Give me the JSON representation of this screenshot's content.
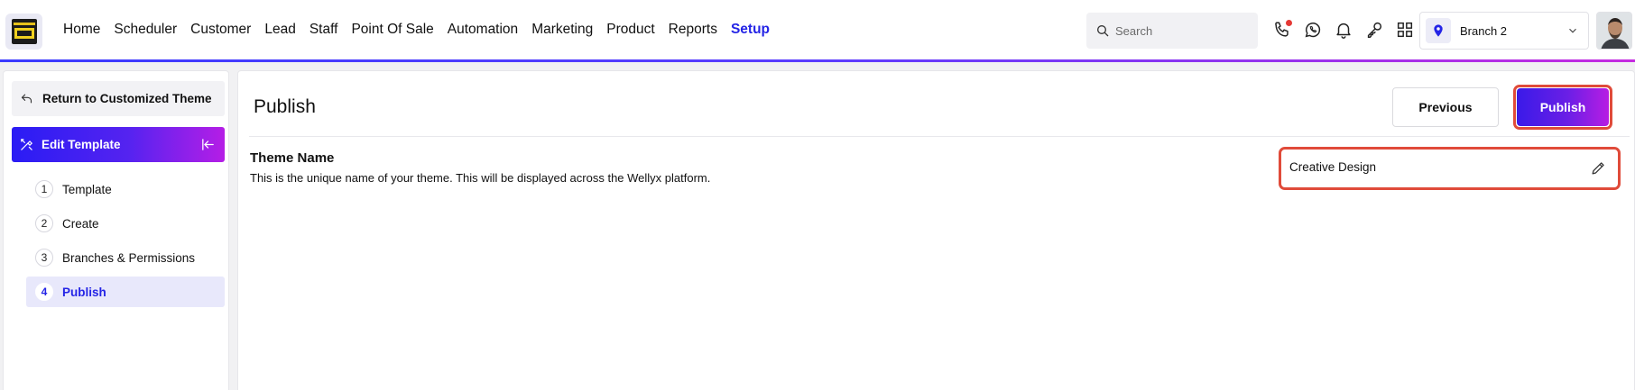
{
  "header": {
    "nav": [
      "Home",
      "Scheduler",
      "Customer",
      "Lead",
      "Staff",
      "Point Of Sale",
      "Automation",
      "Marketing",
      "Product",
      "Reports",
      "Setup"
    ],
    "active_nav": "Setup",
    "search": {
      "placeholder": "Search"
    },
    "icons": [
      "phone-icon",
      "whatsapp-icon",
      "bell-icon",
      "key-icon",
      "apps-grid-icon"
    ],
    "branch": {
      "label": "Branch 2"
    },
    "accent_color": "#2424e6"
  },
  "sidebar": {
    "return_label": "Return to Customized Theme",
    "section_label": "Edit Template",
    "steps": [
      {
        "num": "1",
        "label": "Template"
      },
      {
        "num": "2",
        "label": "Create"
      },
      {
        "num": "3",
        "label": "Branches & Permissions"
      },
      {
        "num": "4",
        "label": "Publish"
      }
    ],
    "active_step": "4"
  },
  "main": {
    "title": "Publish",
    "previous_label": "Previous",
    "publish_label": "Publish",
    "theme_name": {
      "heading": "Theme Name",
      "description": "This is the unique name of your theme. This will be displayed across the Wellyx platform.",
      "value": "Creative Design"
    }
  }
}
